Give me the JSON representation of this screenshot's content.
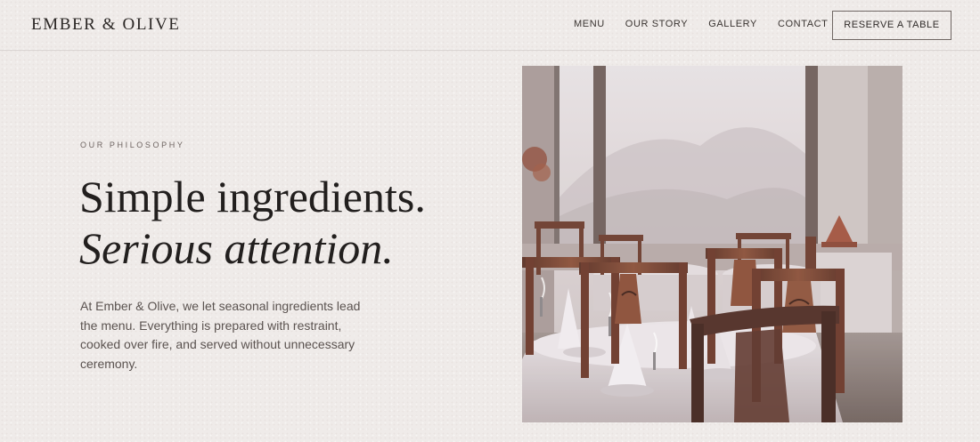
{
  "brand": {
    "name": "EMBER & OLIVE"
  },
  "nav": {
    "items": [
      {
        "label": "MENU"
      },
      {
        "label": "OUR STORY"
      },
      {
        "label": "GALLERY"
      },
      {
        "label": "CONTACT"
      }
    ],
    "cta_label": "RESERVE A TABLE"
  },
  "hero": {
    "eyebrow": "OUR PHILOSOPHY",
    "headline_line1": "Simple ingredients.",
    "headline_line2": "Serious attention.",
    "body": "At Ember & Olive, we let seasonal ingredients lead the menu. Everything is prepared with restraint, cooked over fire, and served without unnecessary ceremony."
  },
  "image": {
    "icon": "restaurant-interior-photo"
  },
  "colors": {
    "background": "#efebe9",
    "text": "#2a2624",
    "muted": "#5b5350",
    "wood": "#7a4632"
  }
}
